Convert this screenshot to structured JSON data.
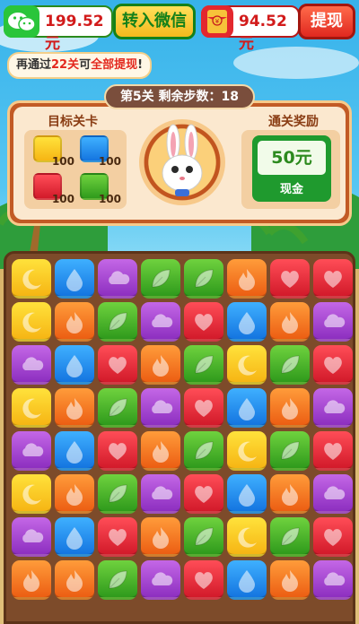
{
  "header": {
    "wechat_balance": "199.52元",
    "transfer_button": "转入微信",
    "redpack_balance": "94.52元",
    "withdraw_button": "提现"
  },
  "tip": {
    "prefix": "再通过",
    "count": "22关",
    "middle": "可",
    "highlight": "全部提现",
    "suffix": "!"
  },
  "level": {
    "label": "第5关  剩余步数：18"
  },
  "goals": {
    "title": "目标关卡",
    "items": [
      {
        "color": "yellow",
        "count": "100"
      },
      {
        "color": "blue",
        "count": "100"
      },
      {
        "color": "red",
        "count": "100"
      },
      {
        "color": "green",
        "count": "100"
      }
    ]
  },
  "reward": {
    "title": "通关奖励",
    "value": "50元",
    "label": "现金"
  },
  "colors": {
    "yellow": "#f6b514",
    "blue": "#1475e0",
    "purple": "#8d2fc0",
    "green": "#2f9a1c",
    "orange": "#ec5e13",
    "red": "#d21a2a"
  },
  "board": [
    [
      "yellow-moon",
      "blue-drop",
      "purple-cloud",
      "green-leaf",
      "green-leaf",
      "orange-fire",
      "red-heart",
      "red-heart"
    ],
    [
      "yellow-moon",
      "orange-fire",
      "green-leaf",
      "purple-cloud",
      "red-heart",
      "blue-drop",
      "orange-fire",
      "purple-cloud"
    ],
    [
      "purple-cloud",
      "blue-drop",
      "red-heart",
      "orange-fire",
      "green-leaf",
      "yellow-moon",
      "green-leaf",
      "red-heart"
    ],
    [
      "yellow-moon",
      "orange-fire",
      "green-leaf",
      "purple-cloud",
      "red-heart",
      "blue-drop",
      "orange-fire",
      "purple-cloud"
    ],
    [
      "purple-cloud",
      "blue-drop",
      "red-heart",
      "orange-fire",
      "green-leaf",
      "yellow-moon",
      "green-leaf",
      "red-heart"
    ],
    [
      "yellow-moon",
      "orange-fire",
      "green-leaf",
      "purple-cloud",
      "red-heart",
      "blue-drop",
      "orange-fire",
      "purple-cloud"
    ],
    [
      "purple-cloud",
      "blue-drop",
      "red-heart",
      "orange-fire",
      "green-leaf",
      "yellow-moon",
      "green-leaf",
      "red-heart"
    ],
    [
      "orange-fire",
      "orange-fire",
      "green-leaf",
      "purple-cloud",
      "red-heart",
      "blue-drop",
      "orange-fire",
      "purple-cloud"
    ]
  ]
}
